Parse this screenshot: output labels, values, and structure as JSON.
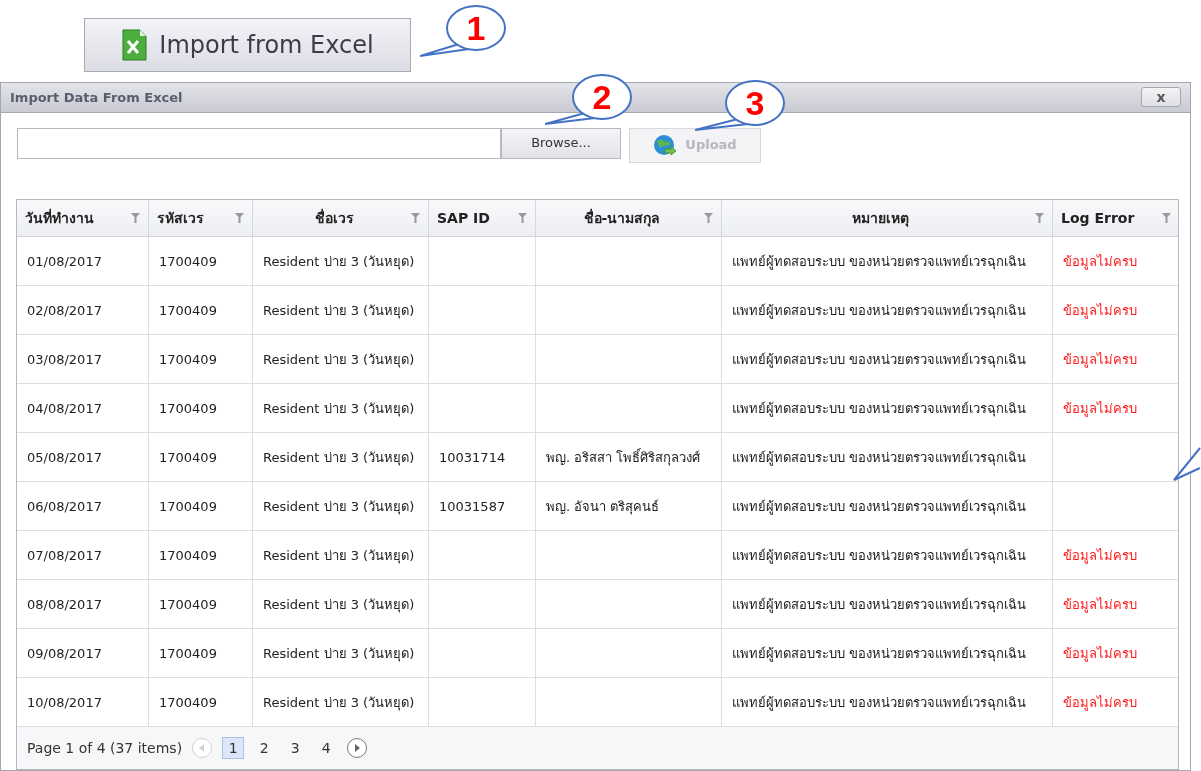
{
  "import_button": {
    "label": "Import from Excel"
  },
  "callouts": [
    {
      "label": "1"
    },
    {
      "label": "2"
    },
    {
      "label": "3"
    }
  ],
  "dialog": {
    "title": "Import Data From Excel",
    "close": "x",
    "browse_button": {
      "label": "Browse..."
    },
    "upload_button": {
      "label": "Upload",
      "disabled": true
    },
    "table": {
      "columns": [
        "วันที่ทำงาน",
        "รหัสเวร",
        "ชื่อเวร",
        "SAP ID",
        "ชื่อ-นามสกุล",
        "หมายเหตุ",
        "Log Error"
      ],
      "rows": [
        [
          "01/08/2017",
          "1700409",
          "Resident บ่าย 3 (วันหยุด)",
          "",
          "",
          "แพทย์ผู้ทดสอบระบบ ของหน่วยตรวจแพทย์เวรฉุกเฉิน",
          "ข้อมูลไม่ครบ"
        ],
        [
          "02/08/2017",
          "1700409",
          "Resident บ่าย 3 (วันหยุด)",
          "",
          "",
          "แพทย์ผู้ทดสอบระบบ ของหน่วยตรวจแพทย์เวรฉุกเฉิน",
          "ข้อมูลไม่ครบ"
        ],
        [
          "03/08/2017",
          "1700409",
          "Resident บ่าย 3 (วันหยุด)",
          "",
          "",
          "แพทย์ผู้ทดสอบระบบ ของหน่วยตรวจแพทย์เวรฉุกเฉิน",
          "ข้อมูลไม่ครบ"
        ],
        [
          "04/08/2017",
          "1700409",
          "Resident บ่าย 3 (วันหยุด)",
          "",
          "",
          "แพทย์ผู้ทดสอบระบบ ของหน่วยตรวจแพทย์เวรฉุกเฉิน",
          "ข้อมูลไม่ครบ"
        ],
        [
          "05/08/2017",
          "1700409",
          "Resident บ่าย 3 (วันหยุด)",
          "10031714",
          "พญ. อริสสา โพธิ์ศิริสกุลวงศ์",
          "แพทย์ผู้ทดสอบระบบ ของหน่วยตรวจแพทย์เวรฉุกเฉิน",
          ""
        ],
        [
          "06/08/2017",
          "1700409",
          "Resident บ่าย 3 (วันหยุด)",
          "10031587",
          "พญ. อัจนา ตริสุคนธ์",
          "แพทย์ผู้ทดสอบระบบ ของหน่วยตรวจแพทย์เวรฉุกเฉิน",
          ""
        ],
        [
          "07/08/2017",
          "1700409",
          "Resident บ่าย 3 (วันหยุด)",
          "",
          "",
          "แพทย์ผู้ทดสอบระบบ ของหน่วยตรวจแพทย์เวรฉุกเฉิน",
          "ข้อมูลไม่ครบ"
        ],
        [
          "08/08/2017",
          "1700409",
          "Resident บ่าย 3 (วันหยุด)",
          "",
          "",
          "แพทย์ผู้ทดสอบระบบ ของหน่วยตรวจแพทย์เวรฉุกเฉิน",
          "ข้อมูลไม่ครบ"
        ],
        [
          "09/08/2017",
          "1700409",
          "Resident บ่าย 3 (วันหยุด)",
          "",
          "",
          "แพทย์ผู้ทดสอบระบบ ของหน่วยตรวจแพทย์เวรฉุกเฉิน",
          "ข้อมูลไม่ครบ"
        ],
        [
          "10/08/2017",
          "1700409",
          "Resident บ่าย 3 (วันหยุด)",
          "",
          "",
          "แพทย์ผู้ทดสอบระบบ ของหน่วยตรวจแพทย์เวรฉุกเฉิน",
          "ข้อมูลไม่ครบ"
        ]
      ]
    },
    "pager": {
      "summary": "Page 1 of 4 (37 items)",
      "prev_disabled": true,
      "pages": [
        {
          "label": "1",
          "selected": true
        },
        {
          "label": "2",
          "selected": false
        },
        {
          "label": "3",
          "selected": false
        },
        {
          "label": "4",
          "selected": false
        }
      ]
    }
  }
}
